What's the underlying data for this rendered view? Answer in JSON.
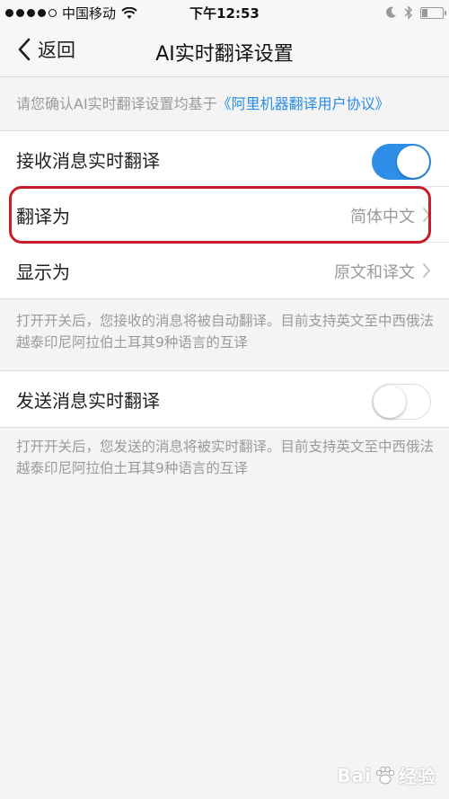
{
  "status_bar": {
    "carrier": "中国移动",
    "time": "下午12:53"
  },
  "nav": {
    "back_label": "返回",
    "title": "AI实时翻译设置"
  },
  "notice": {
    "text": "请您确认AI实时翻译设置均基于",
    "link": "《阿里机器翻译用户协议》"
  },
  "receive_group": {
    "receive_toggle_label": "接收消息实时翻译",
    "receive_toggle_on": true,
    "translate_to_label": "翻译为",
    "translate_to_value": "简体中文",
    "display_as_label": "显示为",
    "display_as_value": "原文和译文"
  },
  "receive_desc": "打开开关后，您接收的消息将被自动翻译。目前支持英文至中西俄法越泰印尼阿拉伯土耳其9种语言的互译",
  "send_group": {
    "send_toggle_label": "发送消息实时翻译",
    "send_toggle_on": false
  },
  "send_desc": "打开开关后，您发送的消息将被实时翻译。目前支持英文至中西俄法越泰印尼阿拉伯土耳其9种语言的互译",
  "colors": {
    "accent": "#2f8fe8",
    "link": "#2a8ce3",
    "highlight": "#c81e2a"
  },
  "watermark": {
    "prefix": "Bai",
    "suffix": "经验"
  }
}
